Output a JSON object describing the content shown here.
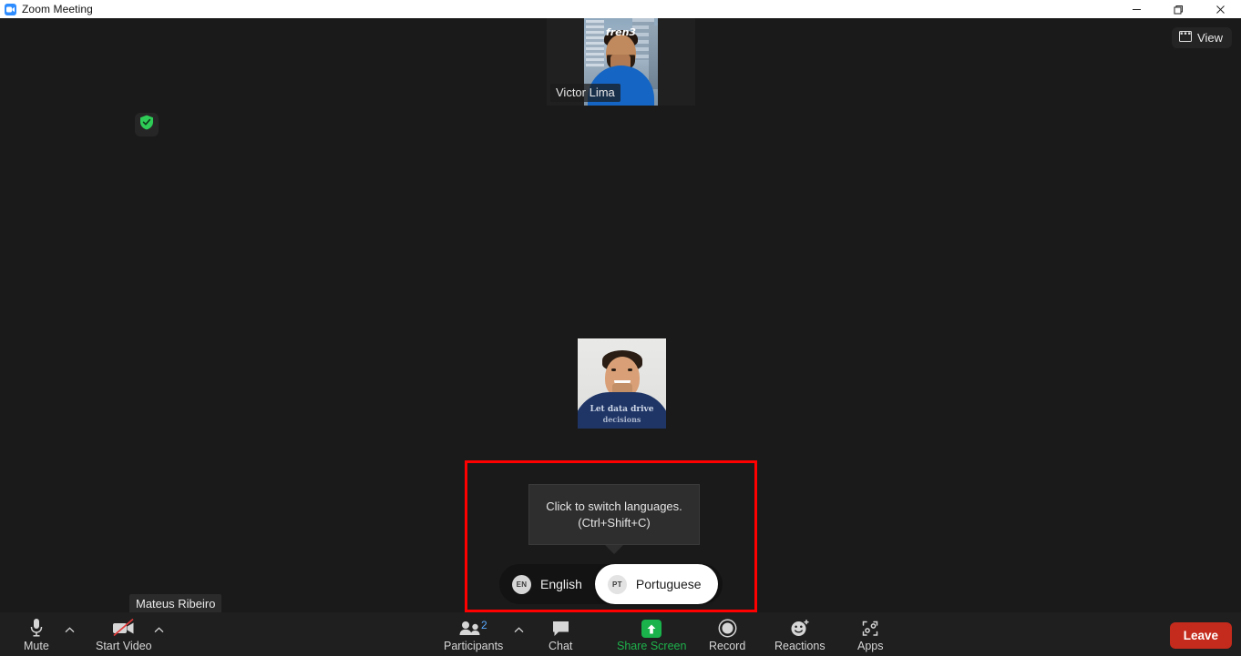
{
  "window": {
    "title": "Zoom Meeting",
    "logo_icon": "zoom-camera-icon",
    "minimize_icon": "minimize-icon",
    "maximize_icon": "maximize-restore-icon",
    "close_icon": "close-icon"
  },
  "topbar": {
    "view_label": "View",
    "view_icon": "grid-layout-icon"
  },
  "security": {
    "shield_icon": "green-shield-check-icon"
  },
  "thumbnails": [
    {
      "name": "Victor Lima",
      "shirt_text": "fren3"
    }
  ],
  "speaker": {
    "shirt_line1": "Let data drive",
    "shirt_line2": "decisions"
  },
  "self_view": {
    "name": "Mateus Ribeiro"
  },
  "tooltip": {
    "line1": "Click to switch languages.",
    "line2": "(Ctrl+Shift+C)"
  },
  "language_toggle": {
    "options": [
      {
        "code": "EN",
        "label": "English",
        "active": false
      },
      {
        "code": "PT",
        "label": "Portuguese",
        "active": true
      }
    ]
  },
  "toolbar": {
    "mute": {
      "label": "Mute",
      "icon": "microphone-icon"
    },
    "video": {
      "label": "Start Video",
      "icon": "camera-off-icon"
    },
    "participants": {
      "label": "Participants",
      "icon": "people-icon",
      "count": "2"
    },
    "chat": {
      "label": "Chat",
      "icon": "chat-bubble-icon"
    },
    "share": {
      "label": "Share Screen",
      "icon": "share-arrow-up-icon"
    },
    "record": {
      "label": "Record",
      "icon": "record-circle-icon"
    },
    "reactions": {
      "label": "Reactions",
      "icon": "smiley-plus-icon"
    },
    "apps": {
      "label": "Apps",
      "icon": "apps-frame-icon"
    },
    "leave": {
      "label": "Leave"
    },
    "caret_icon": "chevron-up-icon"
  },
  "colors": {
    "background": "#1a1a1a",
    "toolbar": "#1f1f1f",
    "accent_blue": "#2d8cff",
    "share_green": "#19b24b",
    "leave_red": "#c42b1c",
    "annotation_red": "#ff0000",
    "shield_green": "#2ecc57"
  }
}
